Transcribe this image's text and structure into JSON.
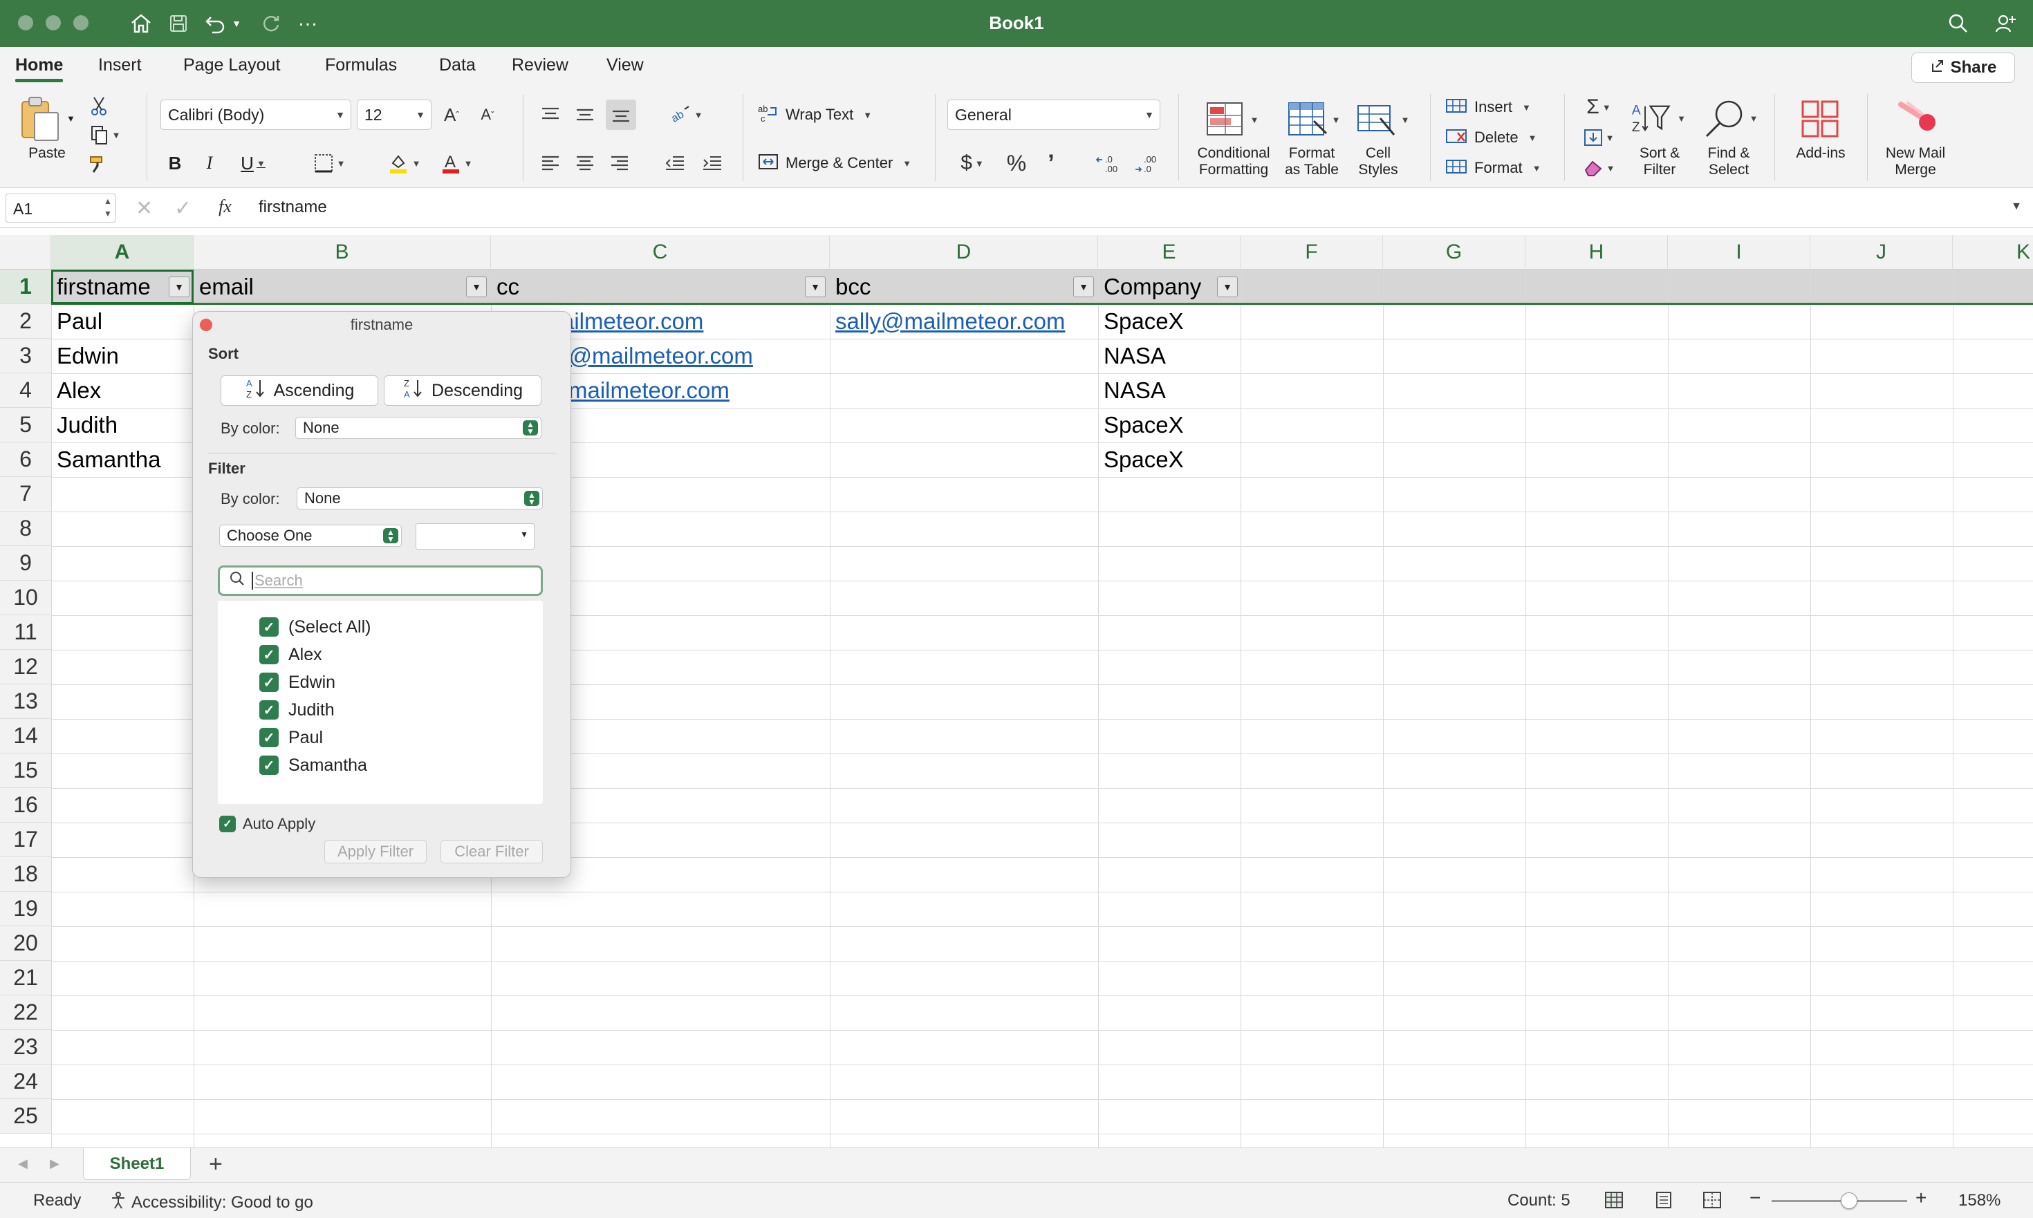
{
  "window": {
    "title": "Book1"
  },
  "tabs": [
    "Home",
    "Insert",
    "Page Layout",
    "Formulas",
    "Data",
    "Review",
    "View"
  ],
  "share_label": "Share",
  "ribbon": {
    "paste": "Paste",
    "font_name": "Calibri (Body)",
    "font_size": "12",
    "wrap_text": "Wrap Text",
    "merge_center": "Merge & Center",
    "number_format": "General",
    "conditional_formatting": [
      "Conditional",
      "Formatting"
    ],
    "format_as_table": [
      "Format",
      "as Table"
    ],
    "cell_styles": [
      "Cell",
      "Styles"
    ],
    "insert": "Insert",
    "delete": "Delete",
    "format": "Format",
    "sort_filter": [
      "Sort &",
      "Filter"
    ],
    "find_select": [
      "Find &",
      "Select"
    ],
    "addins": "Add-ins",
    "new_mail_merge": [
      "New Mail",
      "Merge"
    ]
  },
  "formula_bar": {
    "name_box": "A1",
    "fx": "fx",
    "content": "firstname"
  },
  "columns": [
    "A",
    "B",
    "C",
    "D",
    "E",
    "F",
    "G",
    "H",
    "I",
    "J",
    "K"
  ],
  "rows": [
    "1",
    "2",
    "3",
    "4",
    "5",
    "6",
    "7",
    "8",
    "9",
    "10",
    "11",
    "12",
    "13",
    "14",
    "15",
    "16",
    "17",
    "18",
    "19",
    "20",
    "21",
    "22",
    "23",
    "24",
    "25"
  ],
  "headers": {
    "a": "firstname",
    "b": "email",
    "c": "cc",
    "d": "bcc",
    "e": "Company"
  },
  "cells": {
    "a": [
      "Paul",
      "Edwin",
      "Alex",
      "Judith",
      "Samantha"
    ],
    "c": [
      "ailmeteor.com",
      "s@mailmeteor.com",
      "mailmeteor.com"
    ],
    "d": [
      "sally@mailmeteor.com"
    ],
    "e": [
      "SpaceX",
      "NASA",
      "NASA",
      "SpaceX",
      "SpaceX"
    ]
  },
  "filter_popup": {
    "title": "firstname",
    "sort_heading": "Sort",
    "ascending": "Ascending",
    "descending": "Descending",
    "by_color_label": "By color:",
    "sort_by_color": "None",
    "filter_heading": "Filter",
    "filter_by_color": "None",
    "choose_one": "Choose One",
    "search_placeholder": "Search",
    "items": [
      "(Select All)",
      "Alex",
      "Edwin",
      "Judith",
      "Paul",
      "Samantha"
    ],
    "auto_apply": "Auto Apply",
    "apply_filter": "Apply Filter",
    "clear_filter": "Clear Filter"
  },
  "sheet": {
    "tab": "Sheet1"
  },
  "status": {
    "ready": "Ready",
    "accessibility": "Accessibility: Good to go",
    "count": "Count: 5",
    "zoom": "158%"
  },
  "colors": {
    "accent": "#3b7a44",
    "link": "#1a5fb4",
    "checkbox": "#2e7d4f"
  }
}
